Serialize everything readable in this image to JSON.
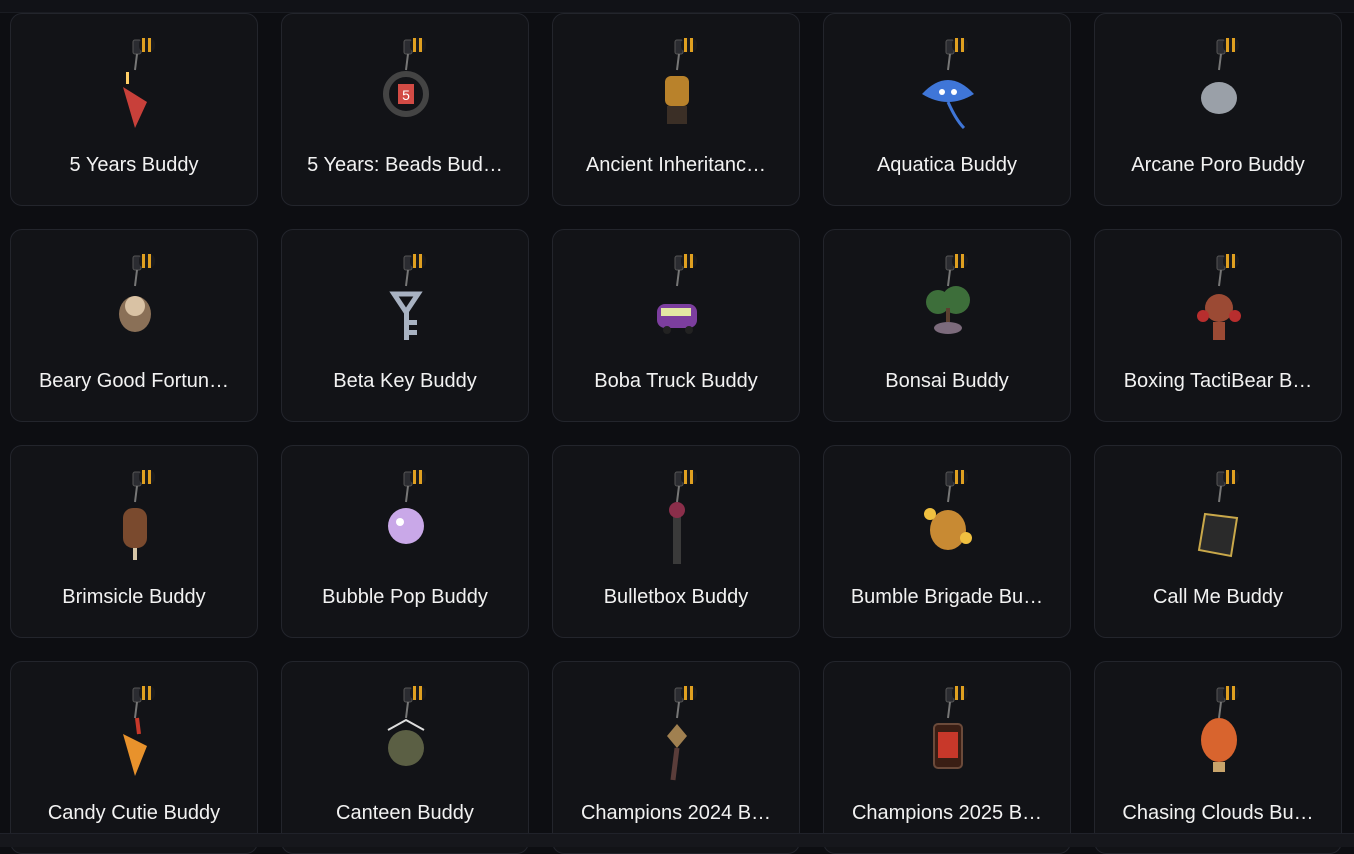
{
  "buddies": [
    {
      "name": "5 Years Buddy",
      "icon": "cake-slice-charm-icon",
      "color": "#c8403a"
    },
    {
      "name": "5 Years: Beads Bud…",
      "icon": "beads-ring-charm-icon",
      "color": "#d24b45"
    },
    {
      "name": "Ancient Inheritanc…",
      "icon": "samurai-mask-charm-icon",
      "color": "#b9822b"
    },
    {
      "name": "Aquatica Buddy",
      "icon": "manta-ray-charm-icon",
      "color": "#3f76d8"
    },
    {
      "name": "Arcane Poro Buddy",
      "icon": "poro-charm-icon",
      "color": "#9aa0a8"
    },
    {
      "name": "Beary Good Fortun…",
      "icon": "raccoon-charm-icon",
      "color": "#8a7057"
    },
    {
      "name": "Beta Key Buddy",
      "icon": "key-charm-icon",
      "color": "#a8b2c2"
    },
    {
      "name": "Boba Truck Buddy",
      "icon": "bus-charm-icon",
      "color": "#7c3e9e"
    },
    {
      "name": "Bonsai Buddy",
      "icon": "bonsai-tree-charm-icon",
      "color": "#3d6e3a"
    },
    {
      "name": "Boxing TactiBear B…",
      "icon": "boxing-bear-charm-icon",
      "color": "#9b4a34"
    },
    {
      "name": "Brimsicle Buddy",
      "icon": "popsicle-charm-icon",
      "color": "#7a4a2e"
    },
    {
      "name": "Bubble Pop Buddy",
      "icon": "bubble-creature-charm-icon",
      "color": "#c9a8e8"
    },
    {
      "name": "Bulletbox Buddy",
      "icon": "chainsaw-charm-icon",
      "color": "#8a2e4a"
    },
    {
      "name": "Bumble Brigade Bu…",
      "icon": "beehive-charm-icon",
      "color": "#c88a33"
    },
    {
      "name": "Call Me Buddy",
      "icon": "card-charm-icon",
      "color": "#2a2a2a"
    },
    {
      "name": "Candy Cutie Buddy",
      "icon": "candy-corn-charm-icon",
      "color": "#e8922c"
    },
    {
      "name": "Canteen Buddy",
      "icon": "canteen-charm-icon",
      "color": "#5b5f44"
    },
    {
      "name": "Champions 2024 B…",
      "icon": "feather-charm-icon",
      "color": "#5a3d3a"
    },
    {
      "name": "Champions 2025 B…",
      "icon": "champions-tag-charm-icon",
      "color": "#c8382a"
    },
    {
      "name": "Chasing Clouds Bu…",
      "icon": "hot-air-balloon-charm-icon",
      "color": "#d8642e"
    }
  ]
}
